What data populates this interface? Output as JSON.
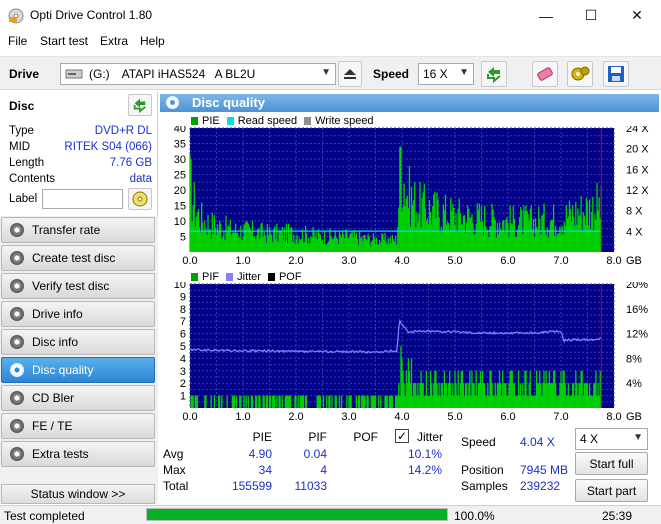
{
  "window": {
    "title": "Opti Drive Control 1.80",
    "minimize": "—",
    "maximize": "☐",
    "close": "✕"
  },
  "menu": [
    "File",
    "Start test",
    "Extra",
    "Help"
  ],
  "toolbar": {
    "drive_label": "Drive",
    "drive_letter": "(G:)",
    "drive_name": "ATAPI iHAS524   A BL2U",
    "speed_label": "Speed",
    "speed_value": "16 X"
  },
  "disc": {
    "title": "Disc",
    "type_label": "Type",
    "type_value": "DVD+R DL",
    "mid_label": "MID",
    "mid_value": "RITEK S04 (066)",
    "length_label": "Length",
    "length_value": "7.76 GB",
    "contents_label": "Contents",
    "contents_value": "data",
    "label_label": "Label",
    "label_value": ""
  },
  "nav": [
    {
      "label": "Transfer rate",
      "active": false
    },
    {
      "label": "Create test disc",
      "active": false
    },
    {
      "label": "Verify test disc",
      "active": false
    },
    {
      "label": "Drive info",
      "active": false
    },
    {
      "label": "Disc info",
      "active": false
    },
    {
      "label": "Disc quality",
      "active": true
    },
    {
      "label": "CD Bler",
      "active": false
    },
    {
      "label": "FE / TE",
      "active": false
    },
    {
      "label": "Extra tests",
      "active": false
    }
  ],
  "status_window_label": "Status window >>",
  "statusbar": {
    "text": "Test completed",
    "progress_percent": 100,
    "progress_text": "100.0%",
    "time": "25:39"
  },
  "panel_title": "Disc quality",
  "chart_data": [
    {
      "type": "bar",
      "legend": [
        {
          "name": "PIE",
          "color": "#00a000"
        },
        {
          "name": "Read speed",
          "color": "#00e0e0"
        },
        {
          "name": "Write speed",
          "color": "#909090"
        }
      ],
      "x_ticks": [
        "0.0",
        "1.0",
        "2.0",
        "3.0",
        "4.0",
        "5.0",
        "6.0",
        "7.0",
        "8.0"
      ],
      "x_unit": "GB",
      "xlim": [
        0,
        8
      ],
      "y_left_ticks": [
        "5",
        "10",
        "15",
        "20",
        "25",
        "30",
        "35",
        "40"
      ],
      "ylim": [
        0,
        40
      ],
      "y_right_ticks": [
        "4 X",
        "8 X",
        "12 X",
        "16 X",
        "20 X",
        "24 X"
      ],
      "y_right_lim": [
        0,
        24
      ],
      "series": [
        {
          "name": "PIE",
          "x": [
            0.0,
            0.1,
            0.2,
            0.4,
            0.6,
            0.8,
            1.0,
            1.5,
            2.0,
            2.5,
            3.0,
            3.5,
            3.9,
            3.95,
            4.0,
            4.1,
            4.3,
            4.5,
            5.0,
            5.5,
            6.0,
            6.5,
            7.0,
            7.3,
            7.5,
            7.7,
            7.76
          ],
          "values": [
            22,
            14,
            11,
            9,
            8,
            7,
            7,
            6,
            6,
            5,
            5,
            4,
            4,
            20,
            27,
            19,
            15,
            14,
            12,
            11,
            10,
            10,
            11,
            13,
            14,
            15,
            14
          ]
        },
        {
          "name": "Read speed",
          "x": [
            0.0,
            7.76
          ],
          "values": [
            4.04,
            4.04
          ]
        }
      ]
    },
    {
      "type": "bar",
      "legend": [
        {
          "name": "PIF",
          "color": "#00a000"
        },
        {
          "name": "Jitter",
          "color": "#8080ff"
        },
        {
          "name": "POF",
          "color": "#000000"
        }
      ],
      "x_ticks": [
        "0.0",
        "1.0",
        "2.0",
        "3.0",
        "4.0",
        "5.0",
        "6.0",
        "7.0",
        "8.0"
      ],
      "x_unit": "GB",
      "xlim": [
        0,
        8
      ],
      "y_left_ticks": [
        "1",
        "2",
        "3",
        "4",
        "5",
        "6",
        "7",
        "8",
        "9",
        "10"
      ],
      "ylim": [
        0,
        10
      ],
      "y_right_ticks": [
        "4%",
        "8%",
        "12%",
        "16%",
        "20%"
      ],
      "y_right_lim": [
        0,
        20
      ],
      "series": [
        {
          "name": "PIF",
          "x": [
            0.0,
            0.5,
            1.0,
            1.5,
            2.0,
            2.5,
            3.0,
            3.5,
            3.9,
            4.0,
            4.1,
            4.5,
            5.0,
            5.5,
            6.0,
            6.5,
            7.0,
            7.5,
            7.76
          ],
          "values": [
            1,
            1,
            1,
            1,
            1,
            1,
            1,
            1,
            1,
            4,
            3,
            2,
            2,
            2,
            2,
            2,
            2,
            2,
            2
          ]
        },
        {
          "name": "Jitter",
          "x": [
            0.0,
            0.5,
            1.0,
            1.5,
            2.0,
            2.5,
            3.0,
            3.5,
            3.9,
            3.95,
            4.05,
            4.1,
            4.5,
            5.0,
            5.5,
            6.0,
            6.5,
            7.0,
            7.05,
            7.1,
            7.5,
            7.76
          ],
          "values": [
            9.4,
            9.3,
            9.2,
            9.2,
            9.1,
            9.1,
            9.1,
            9.0,
            9.2,
            14.1,
            13.0,
            12.3,
            12.4,
            12.3,
            12.1,
            12.1,
            12.1,
            12.4,
            10.8,
            11.0,
            11.0,
            11.2
          ]
        }
      ]
    }
  ],
  "stats": {
    "col_pie": "PIE",
    "col_pif": "PIF",
    "col_pof": "POF",
    "col_jitter": "Jitter",
    "avg_label": "Avg",
    "max_label": "Max",
    "total_label": "Total",
    "avg_pie": "4.90",
    "avg_pif": "0.04",
    "avg_jitter": "10.1%",
    "max_pie": "34",
    "max_pif": "4",
    "max_jitter": "14.2%",
    "total_pie": "155599",
    "total_pif": "11033",
    "jitter_checked": true
  },
  "info": {
    "speed_label": "Speed",
    "speed_value": "4.04 X",
    "position_label": "Position",
    "position_value": "7945 MB",
    "samples_label": "Samples",
    "samples_value": "239232",
    "speed_select": "4 X",
    "start_full": "Start full",
    "start_part": "Start part"
  }
}
